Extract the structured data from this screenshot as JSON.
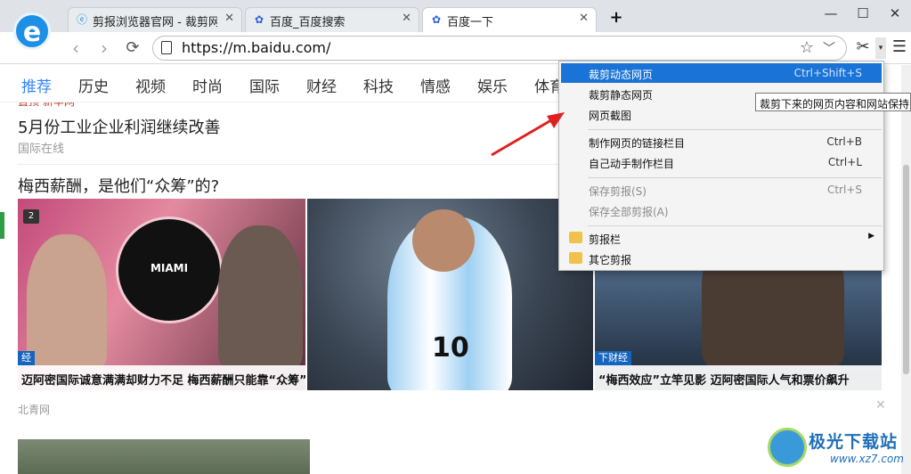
{
  "browser": {
    "tabs": [
      {
        "label": "剪报浏览器官网 - 裁剪网",
        "icon": "e-browser-icon",
        "active": false
      },
      {
        "label": "百度_百度搜索",
        "icon": "baidu-paw-icon",
        "active": false
      },
      {
        "label": "百度一下",
        "icon": "baidu-paw-icon",
        "active": true
      }
    ],
    "new_tab": "+",
    "window_controls": {
      "minimize": "—",
      "maximize": "☐",
      "close": "✕"
    },
    "url": "https://m.baidu.com/"
  },
  "categories": [
    "推荐",
    "历史",
    "视频",
    "时尚",
    "国际",
    "财经",
    "科技",
    "情感",
    "娱乐",
    "体育"
  ],
  "feed": {
    "top_source": "置顶  新华网",
    "headline1": "5月份工业企业利润继续改善",
    "source1": "国际在线",
    "headline2": "梅西薪酬，是他们“众筹”的?",
    "images": {
      "img1_badge": "2",
      "img1_emblem": "MIAMI",
      "img1_tag": "经",
      "img1_caption": "迈阿密国际诚意满满却财力不足 梅西薪酬只能靠“众筹”",
      "img2_jersey": "10",
      "img3_tag": "下财经",
      "img3_caption": "“梅西效应”立竿见影 迈阿密国际人气和票价飙升"
    },
    "source2": "北青网",
    "close": "✕"
  },
  "dropdown": {
    "items": [
      {
        "label": "裁剪动态网页",
        "shortcut": "Ctrl+Shift+S",
        "highlighted": true
      },
      {
        "label": "裁剪静态网页",
        "shortcut": ""
      },
      {
        "label": "网页截图",
        "shortcut": ""
      },
      {
        "label": "制作网页的链接栏目",
        "shortcut": "Ctrl+B"
      },
      {
        "label": "自己动手制作栏目",
        "shortcut": "Ctrl+L"
      },
      {
        "label": "保存剪报(S)",
        "shortcut": "Ctrl+S",
        "disabled": true
      },
      {
        "label": "保存全部剪报(A)",
        "shortcut": "",
        "disabled": true
      },
      {
        "label": "剪报栏",
        "submenu": "▶"
      },
      {
        "label": "其它剪报",
        "submenu": ""
      }
    ]
  },
  "tooltip": "裁剪下来的网页内容和网站保持同步",
  "watermark": {
    "title": "极光下载站",
    "sub": "www.xz7.com"
  },
  "colors": {
    "accent": "#3385ff",
    "menu_highlight": "#1a73d6",
    "arrow": "#e02020"
  }
}
